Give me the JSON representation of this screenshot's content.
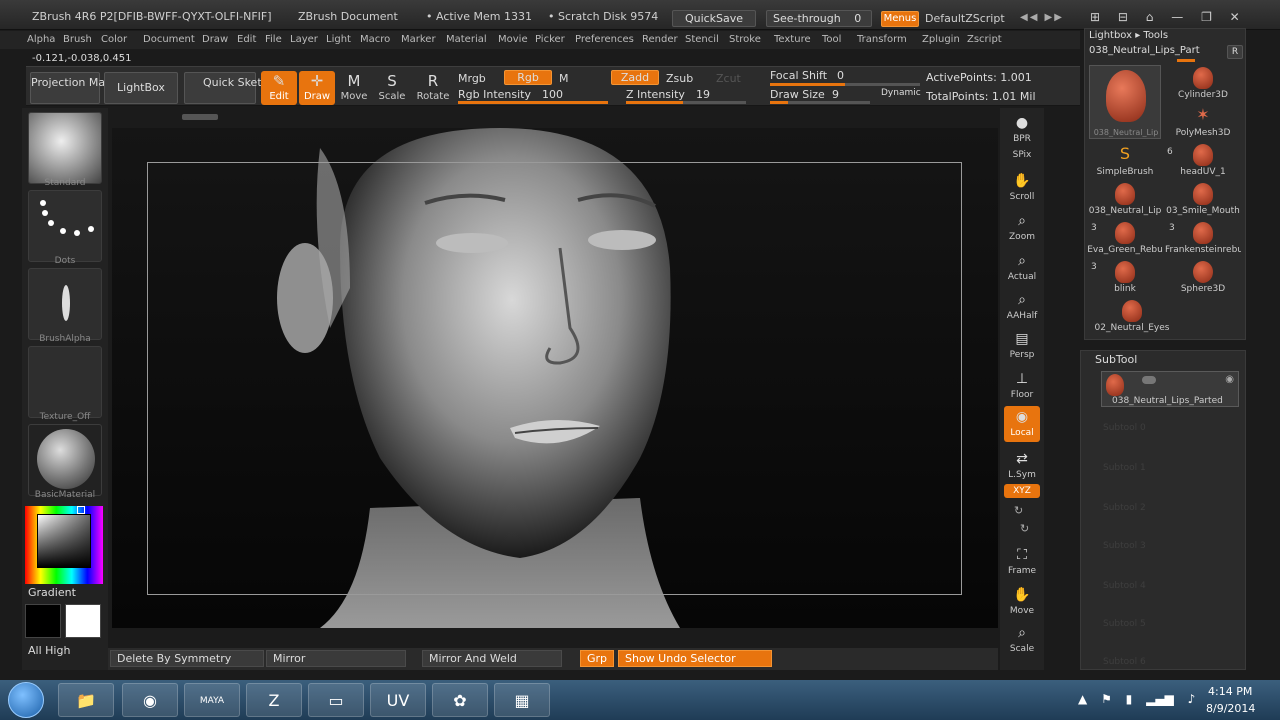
{
  "titlebar": {
    "app_title": "ZBrush 4R6 P2[DFIB-BWFF-QYXT-OLFI-NFIF]",
    "document": "ZBrush Document",
    "active_mem": "• Active Mem 1331",
    "scratch_disk": "• Scratch Disk 9574",
    "quicksave": "QuickSave",
    "see_through_label": "See-through",
    "see_through_value": "0",
    "menus": "Menus",
    "zscript": "DefaultZScript"
  },
  "menu": [
    "Alpha",
    "Brush",
    "Color",
    "Document",
    "Draw",
    "Edit",
    "File",
    "Layer",
    "Light",
    "Macro",
    "Marker",
    "Material",
    "Movie",
    "Picker",
    "Preferences",
    "Render",
    "Stencil",
    "Stroke",
    "Texture",
    "Tool",
    "Transform",
    "Zplugin",
    "Zscript"
  ],
  "coords": "-0.121,-0.038,0.451",
  "toolbar": {
    "projection_master": "Projection Master",
    "lightbox": "LightBox",
    "quick_sketch": "Quick Sketch",
    "edit": "Edit",
    "draw": "Draw",
    "move": "Move",
    "scale": "Scale",
    "rotate": "Rotate",
    "mrgb": "Mrgb",
    "rgb": "Rgb",
    "m": "M",
    "zadd": "Zadd",
    "zsub": "Zsub",
    "zcut": "Zcut",
    "rgb_intensity_label": "Rgb Intensity",
    "rgb_intensity": "100",
    "z_intensity_label": "Z Intensity",
    "z_intensity": "19",
    "focal_shift_label": "Focal Shift",
    "focal_shift": "0",
    "draw_size_label": "Draw Size",
    "draw_size": "9",
    "dynamic": "Dynamic",
    "active_points": "ActivePoints: 1.001",
    "total_points": "TotalPoints: 1.01 Mil"
  },
  "left_shelf": {
    "brush": "Standard",
    "stroke": "Dots",
    "alpha": "BrushAlpha",
    "texture": "Texture_Off",
    "material": "BasicMaterial",
    "gradient": "Gradient",
    "all_high": "All High"
  },
  "right_shelf": [
    {
      "label": "BPR",
      "glyph": "●"
    },
    {
      "label": "SPix",
      "glyph": ""
    },
    {
      "label": "Scroll",
      "glyph": "✋"
    },
    {
      "label": "Zoom",
      "glyph": "⌕"
    },
    {
      "label": "Actual",
      "glyph": "⌕"
    },
    {
      "label": "AAHalf",
      "glyph": "⌕"
    },
    {
      "label": "Persp",
      "glyph": "▤"
    },
    {
      "label": "Floor",
      "glyph": "⊥"
    },
    {
      "label": "Local",
      "glyph": "◉"
    },
    {
      "label": "L.Sym",
      "glyph": "⇄"
    },
    {
      "label": "XYZ",
      "glyph": ""
    },
    {
      "label": "Frame",
      "glyph": "⛶"
    },
    {
      "label": "Move",
      "glyph": "✋"
    },
    {
      "label": "Scale",
      "glyph": "⌕"
    }
  ],
  "lightbox_panel": {
    "header": "Lightbox ▸ Tools",
    "current_tool": "038_Neutral_Lips_Part",
    "r_button": "R",
    "tools": [
      {
        "name": "038_Neutral_Lip",
        "count": ""
      },
      {
        "name": "Cylinder3D",
        "count": ""
      },
      {
        "name": "PolyMesh3D",
        "count": ""
      },
      {
        "name": "SimpleBrush",
        "count": "6"
      },
      {
        "name": "headUV_1",
        "count": ""
      },
      {
        "name": "038_Neutral_Lip",
        "count": "3"
      },
      {
        "name": "03_Smile_Mouth",
        "count": "3"
      },
      {
        "name": "Eva_Green_Rebu",
        "count": "3"
      },
      {
        "name": "Frankensteinrebu",
        "count": ""
      },
      {
        "name": "blink",
        "count": ""
      },
      {
        "name": "Sphere3D",
        "count": ""
      },
      {
        "name": "02_Neutral_Eyes",
        "count": ""
      }
    ]
  },
  "subtool": {
    "header": "SubTool",
    "item": "038_Neutral_Lips_Parted",
    "ghosts": [
      "Subtool 0",
      "Subtool 1",
      "Subtool 2",
      "Subtool 3",
      "Subtool 4",
      "Subtool 5",
      "Subtool 6"
    ]
  },
  "bottombar": {
    "delete_by_symmetry": "Delete By Symmetry",
    "mirror": "Mirror",
    "mirror_and_weld": "Mirror And Weld",
    "grp": "Grp",
    "show_undo_selector": "Show Undo Selector"
  },
  "taskbar": {
    "time": "4:14 PM",
    "date": "8/9/2014",
    "items": [
      "start-orb",
      "explorer",
      "chrome",
      "maya",
      "zbrush",
      "window",
      "uv",
      "flower",
      "app"
    ],
    "uv_label": "UV",
    "maya_label": "MAYA"
  },
  "colors": {
    "accent": "#e8740e",
    "panel": "#2b2b2b",
    "taskbar": "#2b4c68"
  }
}
